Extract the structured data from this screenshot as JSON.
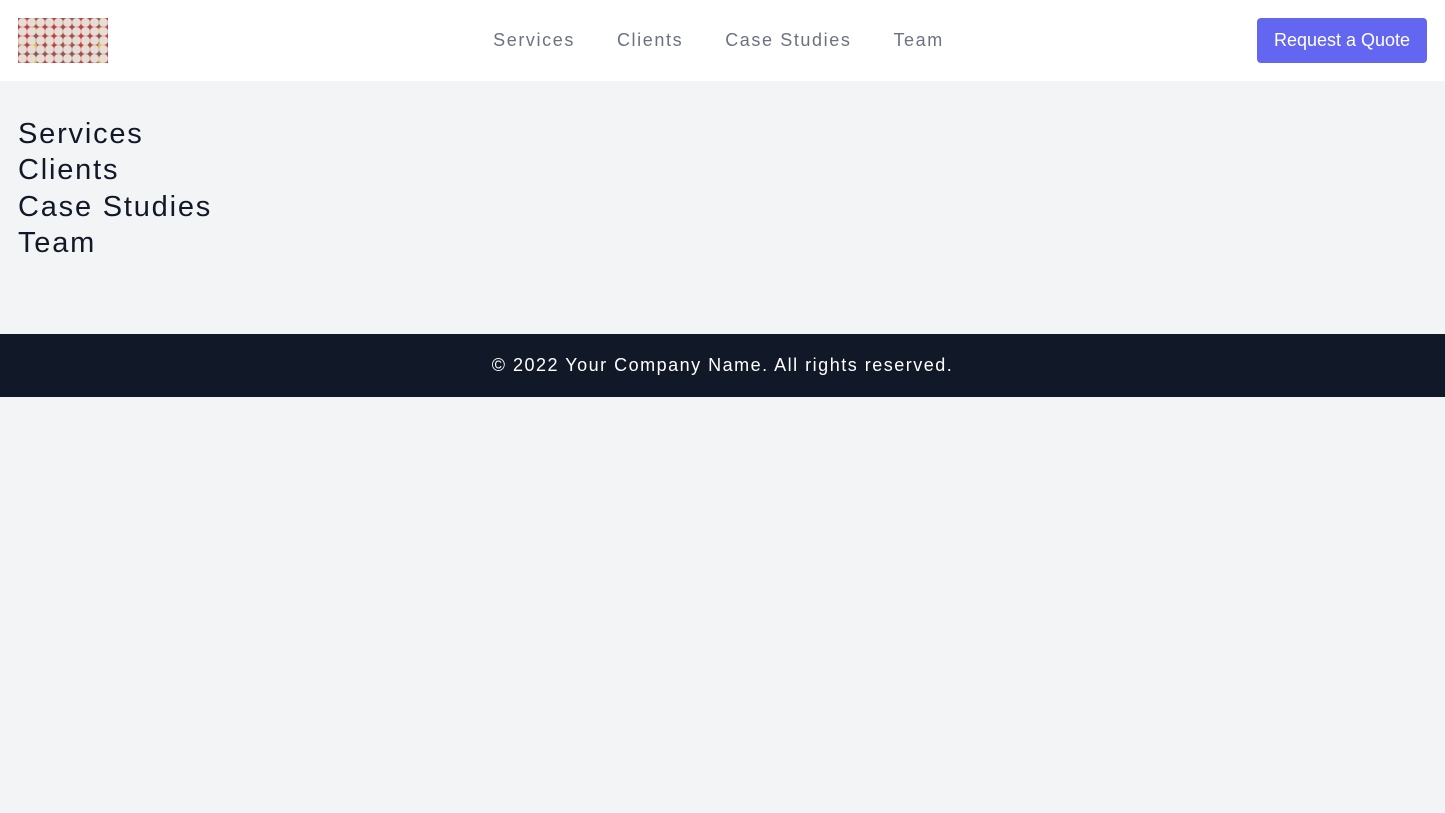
{
  "header": {
    "logo_alt": "Company logo",
    "nav": [
      {
        "label": "Services"
      },
      {
        "label": "Clients"
      },
      {
        "label": "Case Studies"
      },
      {
        "label": "Team"
      }
    ],
    "cta_label": "Request a Quote",
    "cta_color": "#6366f1"
  },
  "main": {
    "links": [
      {
        "label": "Services"
      },
      {
        "label": "Clients"
      },
      {
        "label": "Case Studies"
      },
      {
        "label": "Team"
      }
    ]
  },
  "footer": {
    "copyright": "© 2022 Your Company Name. All rights reserved."
  }
}
